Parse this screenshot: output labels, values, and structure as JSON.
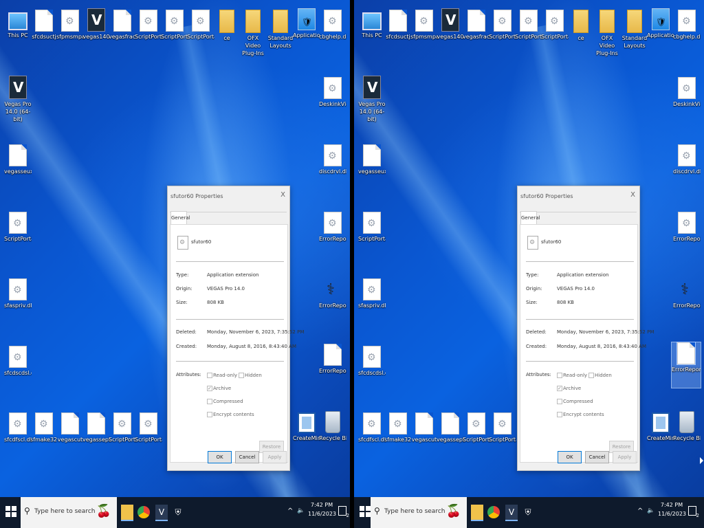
{
  "desktop": {
    "top_row": [
      {
        "label": "This PC",
        "icon": "pc"
      },
      {
        "label": "sfcdsuctj",
        "icon": "doc"
      },
      {
        "label": "sfpmsmpa...",
        "icon": "gear"
      },
      {
        "label": "vegas140",
        "icon": "vegas"
      },
      {
        "label": "vegasfractut",
        "icon": "doc"
      },
      {
        "label": "ScriptPortal...",
        "icon": "gear"
      },
      {
        "label": "ScriptPortal...",
        "icon": "gear"
      },
      {
        "label": "ScriptPortal...",
        "icon": "gear"
      },
      {
        "label": "ce",
        "icon": "folder"
      },
      {
        "label": "OFX Video Plug-Ins",
        "icon": "folder"
      },
      {
        "label": "Standard Layouts",
        "icon": "folder"
      },
      {
        "label": "Application...",
        "icon": "shield"
      },
      {
        "label": "cbghelp.dll",
        "icon": "gear"
      }
    ],
    "left_col": [
      {
        "label": "Vegas Pro 14.0 (64-bit)",
        "icon": "vegas"
      },
      {
        "label": "vegasseuxtut",
        "icon": "doc"
      },
      {
        "label": "ScriptPortal...",
        "icon": "gear"
      },
      {
        "label": "sfaspriv.dll",
        "icon": "gear"
      },
      {
        "label": "sfcdscdsl.dll",
        "icon": "gear"
      }
    ],
    "right_col": [
      {
        "label": "DeskinkVid...",
        "icon": "gear"
      },
      {
        "label": "discdrvl.dll",
        "icon": "gear"
      },
      {
        "label": "ErrorReport...",
        "icon": "gear"
      },
      {
        "label": "ErrorReport...",
        "icon": "stethoscope"
      },
      {
        "label": "ErrorRepor...",
        "icon": "document-globe"
      }
    ],
    "bottom_row": [
      {
        "label": "sfcdfscl.dll",
        "icon": "gear"
      },
      {
        "label": "sfmake32.dll",
        "icon": "gear"
      },
      {
        "label": "vegascut",
        "icon": "doc"
      },
      {
        "label": "vegasseptor",
        "icon": "doc"
      },
      {
        "label": "ScriptPortal...",
        "icon": "gear"
      },
      {
        "label": "ScriptPortal...",
        "icon": "gear"
      },
      {
        "label": "CreateMini...",
        "icon": "window"
      },
      {
        "label": "Recycle Bin",
        "icon": "recycle-bin"
      }
    ]
  },
  "dialog": {
    "title": "sfutor60 Properties",
    "close": "X",
    "tab": "General",
    "file_name": "sfutor60",
    "type_label": "Type:",
    "type_value": "Application extension",
    "origin_label": "Origin:",
    "origin_value": "VEGAS Pro 14.0",
    "size_label": "Size:",
    "size_value": "808 KB",
    "deleted_label": "Deleted:",
    "deleted_value": "Monday, November 6, 2023, 7:35:52 PM",
    "created_label": "Created:",
    "created_value": "Monday, August 8, 2016, 8:43:40 AM",
    "attributes_label": "Attributes:",
    "attr_readonly": "Read-only",
    "attr_hidden": "Hidden",
    "attr_archive": "Archive",
    "attr_compressed": "Compressed",
    "attr_encrypt": "Encrypt contents",
    "restore": "Restore",
    "ok": "OK",
    "cancel": "Cancel",
    "apply": "Apply"
  },
  "taskbar": {
    "search_placeholder": "Type here to search",
    "time": "7:42 PM",
    "date": "11/6/2023",
    "notifications": "2",
    "tray_up": "^"
  }
}
